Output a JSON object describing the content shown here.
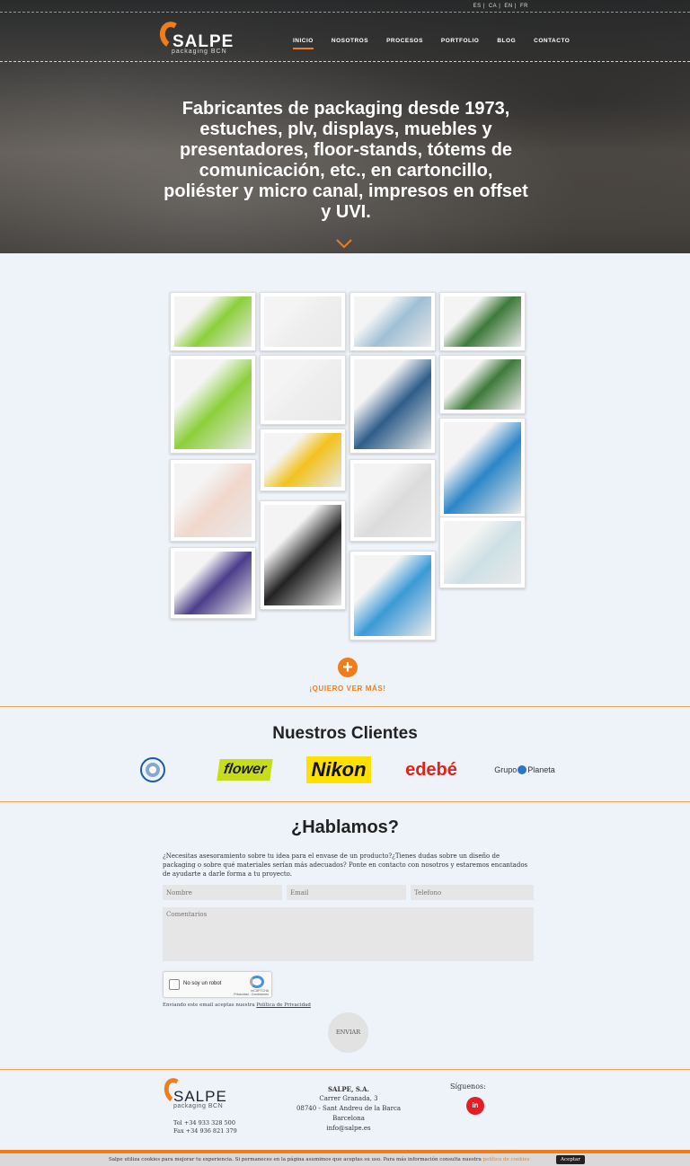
{
  "languages": [
    "ES",
    "CA",
    "EN",
    "FR"
  ],
  "brand": {
    "name": "SALPE",
    "tagline": "packaging BCN"
  },
  "nav": [
    "INICIO",
    "NOSOTROS",
    "PROCESOS",
    "PORTFOLIO",
    "BLOG",
    "CONTACTO"
  ],
  "hero": {
    "headline": "Fabricantes de packaging desde 1973, estuches, plv, displays, muebles y presentadores, floor-stands, tótems de comunicación, etc., en cartoncillo, poliéster y micro canal, impresos en offset y UVI."
  },
  "gallery": {
    "tiles": [
      {
        "name": "velfont-display",
        "color": "#8ccf3a"
      },
      {
        "name": "white-box",
        "color": "#eeeeee"
      },
      {
        "name": "woman-poster-box",
        "color": "#9fbfd6"
      },
      {
        "name": "cheese-box",
        "color": "#3e7a3a"
      },
      {
        "name": "velfont-display-large",
        "color": "#8ccf3a"
      },
      {
        "name": "white-box-2",
        "color": "#eeeeee"
      },
      {
        "name": "juan-marse-totem",
        "color": "#2f5e8a"
      },
      {
        "name": "cheese-box-2",
        "color": "#3e7a3a"
      },
      {
        "name": "yellow-bus-box",
        "color": "#f2c21c"
      },
      {
        "name": "mailbox-stand",
        "color": "#2b86c6"
      },
      {
        "name": "jewelry-boxes",
        "color": "#f1d7cc"
      },
      {
        "name": "neutrogena-display",
        "color": "#dcdcdc"
      },
      {
        "name": "floor-stand-black",
        "color": "#222222"
      },
      {
        "name": "cosmetic-box",
        "color": "#cde0e6"
      },
      {
        "name": "purple-gift-box",
        "color": "#4b3d8a"
      },
      {
        "name": "blue-black-boxes",
        "color": "#3a9ad6"
      }
    ],
    "more_label": "¡QUIERO VER MÁS!"
  },
  "clients": {
    "title": "Nuestros Clientes",
    "logos": [
      "flower",
      "Nikon",
      "edebé",
      "Grupo",
      "Planeta"
    ]
  },
  "contact": {
    "title": "¿Hablamos?",
    "intro": "¿Necesitas asesoramiento sobre tu idea para el envase de un producto?¿Tienes dudas sobre un diseño de packaging o sobre qué materiales serían más adecuados? Ponte en contacto con nosotros y estaremos encantados de ayudarte a darle forma a tu proyecto.",
    "name_placeholder": "Nombre",
    "email_placeholder": "Email",
    "phone_placeholder": "Telefono",
    "comments_placeholder": "Comentarios",
    "captcha_label": "No soy un robot",
    "captcha_brand": "reCAPTCHA",
    "captcha_links": "Privacidad - Condiciones",
    "consent_text": "Enviando este email aceptas nuestra",
    "consent_link": "Política de Privacidad",
    "send_label": "ENVIAR"
  },
  "footer": {
    "phone": "Tel +34 933 328 500",
    "fax": "Fax +34 936 821 379",
    "company": "SALPE, S.A.",
    "street": "Carrer Granada, 3",
    "city": "08740 - Sant Andreu de la Barca",
    "region": "Barcelona",
    "email": "info@salpe.es",
    "follow": "Síguenos:",
    "linkedin": "in"
  },
  "cookie": {
    "text": "Salpe utiliza cookies para mejorar tu experiencia. Si permaneces en la página asumimos que aceptas su uso. Para más información consulta nuestra",
    "link": "política de cookies",
    "accept": "Aceptar"
  },
  "colors": {
    "accent": "#ef7d1b",
    "linkedin": "#e41e26"
  }
}
